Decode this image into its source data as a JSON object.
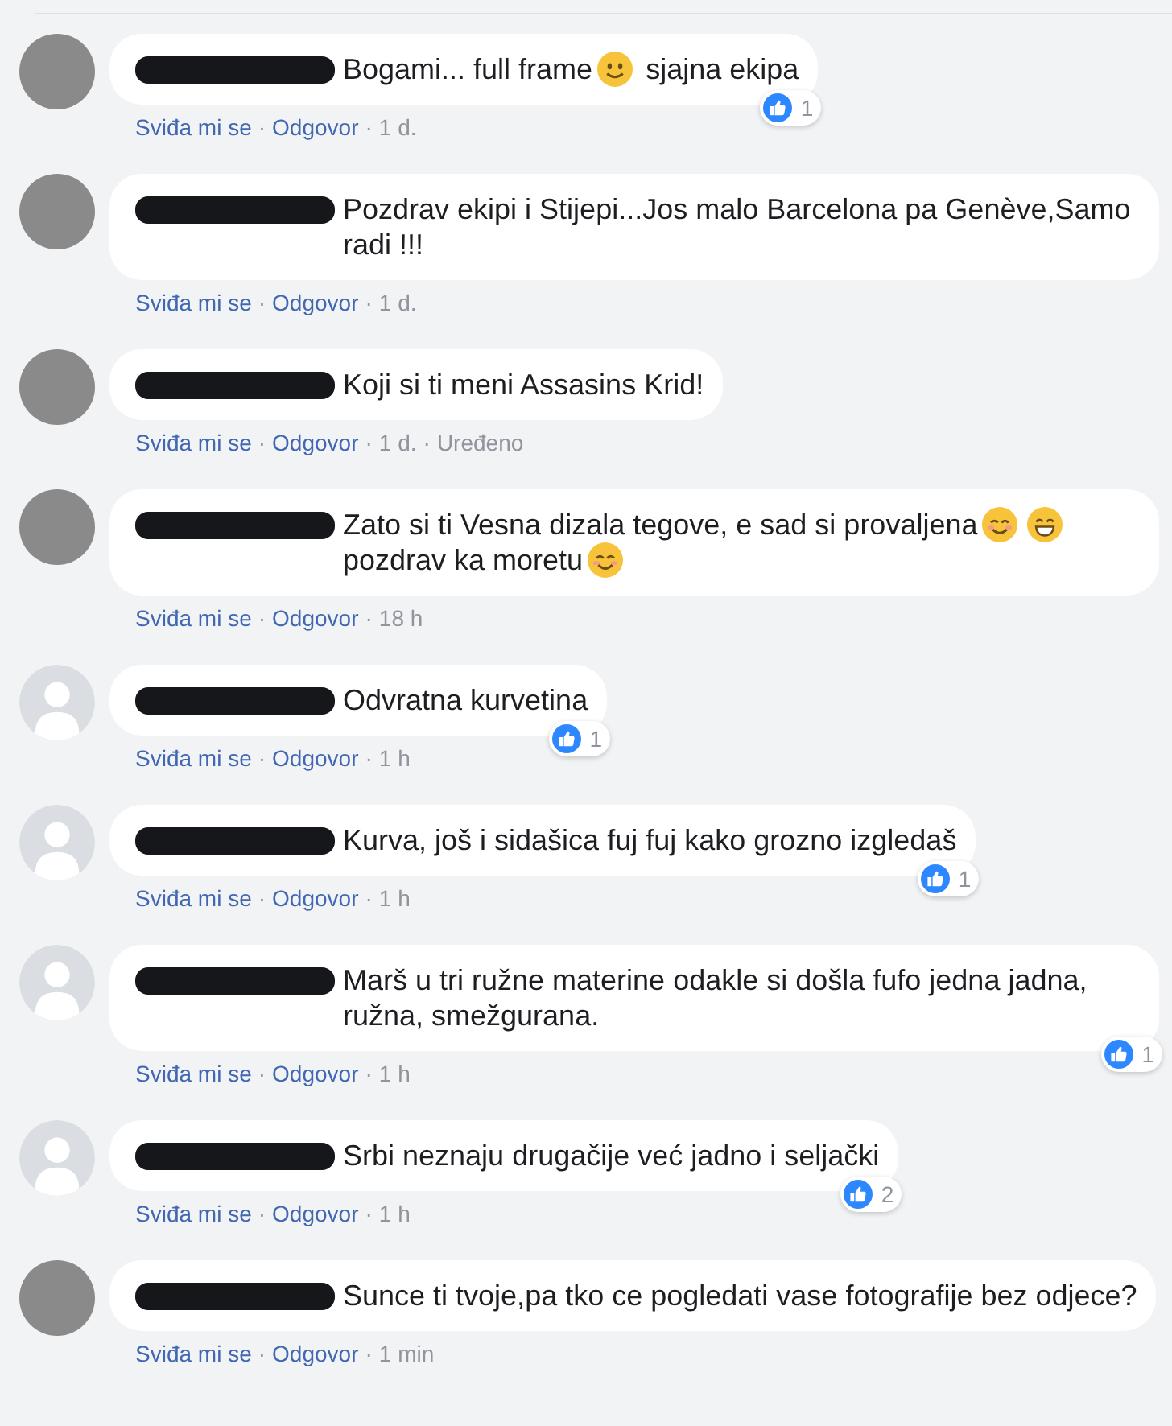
{
  "comments": [
    {
      "avatar": {
        "kind": "photo"
      },
      "name_hidden": true,
      "parts": [
        {
          "kind": "text",
          "text": "Bogami... full frame"
        },
        {
          "kind": "slight-smile-emoji"
        },
        {
          "kind": "text",
          "text": "sjajna ekipa"
        }
      ],
      "reactions": {
        "count": "1"
      },
      "meta": [
        {
          "kind": "link",
          "text": "Sviđa mi se"
        },
        {
          "kind": "dot",
          "text": "·"
        },
        {
          "kind": "link",
          "text": "Odgovor"
        },
        {
          "kind": "dot",
          "text": "·"
        },
        {
          "kind": "time",
          "text": "1 d."
        }
      ]
    },
    {
      "avatar": {
        "kind": "photo"
      },
      "name_hidden": true,
      "parts": [
        {
          "kind": "text",
          "text": "Pozdrav ekipi i Stijepi...Jos malo Barcelona pa Genève,Samo radi !!!"
        }
      ],
      "meta": [
        {
          "kind": "link",
          "text": "Sviđa mi se"
        },
        {
          "kind": "dot",
          "text": "·"
        },
        {
          "kind": "link",
          "text": "Odgovor"
        },
        {
          "kind": "dot",
          "text": "·"
        },
        {
          "kind": "time",
          "text": "1 d."
        }
      ]
    },
    {
      "avatar": {
        "kind": "photo"
      },
      "name_hidden": true,
      "parts": [
        {
          "kind": "text",
          "text": "Koji si ti meni Assasins Krid!"
        }
      ],
      "meta": [
        {
          "kind": "link",
          "text": "Sviđa mi se"
        },
        {
          "kind": "dot",
          "text": "·"
        },
        {
          "kind": "link",
          "text": "Odgovor"
        },
        {
          "kind": "dot",
          "text": "·"
        },
        {
          "kind": "time",
          "text": "1 d."
        },
        {
          "kind": "dot",
          "text": "·"
        },
        {
          "kind": "time",
          "text": "Uređeno"
        }
      ]
    },
    {
      "avatar": {
        "kind": "photo"
      },
      "name_hidden": true,
      "parts": [
        {
          "kind": "text",
          "text": "Zato si ti Vesna dizala tegove, e sad si provaljena"
        },
        {
          "kind": "smiling-eyes-emoji"
        },
        {
          "kind": "grin-emoji"
        },
        {
          "kind": "text",
          "text": "pozdrav ka moretu"
        },
        {
          "kind": "smiling-eyes-emoji"
        }
      ],
      "meta": [
        {
          "kind": "link",
          "text": "Sviđa mi se"
        },
        {
          "kind": "dot",
          "text": "·"
        },
        {
          "kind": "link",
          "text": "Odgovor"
        },
        {
          "kind": "dot",
          "text": "·"
        },
        {
          "kind": "time",
          "text": "18 h"
        }
      ]
    },
    {
      "avatar": {
        "kind": "default"
      },
      "name_hidden": true,
      "parts": [
        {
          "kind": "text",
          "text": "Odvratna kurvetina"
        }
      ],
      "reactions": {
        "count": "1"
      },
      "meta": [
        {
          "kind": "link",
          "text": "Sviđa mi se"
        },
        {
          "kind": "dot",
          "text": "·"
        },
        {
          "kind": "link",
          "text": "Odgovor"
        },
        {
          "kind": "dot",
          "text": "·"
        },
        {
          "kind": "time",
          "text": "1 h"
        }
      ]
    },
    {
      "avatar": {
        "kind": "default"
      },
      "name_hidden": true,
      "parts": [
        {
          "kind": "text",
          "text": "Kurva, još i sidašica fuj fuj kako grozno izgledaš"
        }
      ],
      "reactions": {
        "count": "1"
      },
      "meta": [
        {
          "kind": "link",
          "text": "Sviđa mi se"
        },
        {
          "kind": "dot",
          "text": "·"
        },
        {
          "kind": "link",
          "text": "Odgovor"
        },
        {
          "kind": "dot",
          "text": "·"
        },
        {
          "kind": "time",
          "text": "1 h"
        }
      ]
    },
    {
      "avatar": {
        "kind": "default"
      },
      "name_hidden": true,
      "parts": [
        {
          "kind": "text",
          "text": "Marš u tri ružne materine odakle si došla fufo jedna jadna, ružna, smežgurana."
        }
      ],
      "reactions": {
        "count": "1"
      },
      "meta": [
        {
          "kind": "link",
          "text": "Sviđa mi se"
        },
        {
          "kind": "dot",
          "text": "·"
        },
        {
          "kind": "link",
          "text": "Odgovor"
        },
        {
          "kind": "dot",
          "text": "·"
        },
        {
          "kind": "time",
          "text": "1 h"
        }
      ]
    },
    {
      "avatar": {
        "kind": "default"
      },
      "name_hidden": true,
      "parts": [
        {
          "kind": "text",
          "text": "Srbi neznaju drugačije već jadno i seljački"
        }
      ],
      "reactions": {
        "count": "2"
      },
      "meta": [
        {
          "kind": "link",
          "text": "Sviđa mi se"
        },
        {
          "kind": "dot",
          "text": "·"
        },
        {
          "kind": "link",
          "text": "Odgovor"
        },
        {
          "kind": "dot",
          "text": "·"
        },
        {
          "kind": "time",
          "text": "1 h"
        }
      ]
    },
    {
      "avatar": {
        "kind": "photo"
      },
      "name_hidden": true,
      "parts": [
        {
          "kind": "text",
          "text": "Sunce ti tvoje,pa tko ce pogledati vase fotografije bez odjece?"
        }
      ],
      "meta": [
        {
          "kind": "link",
          "text": "Sviđa mi se"
        },
        {
          "kind": "dot",
          "text": "·"
        },
        {
          "kind": "link",
          "text": "Odgovor"
        },
        {
          "kind": "dot",
          "text": "·"
        },
        {
          "kind": "time",
          "text": "1 min"
        }
      ]
    }
  ]
}
